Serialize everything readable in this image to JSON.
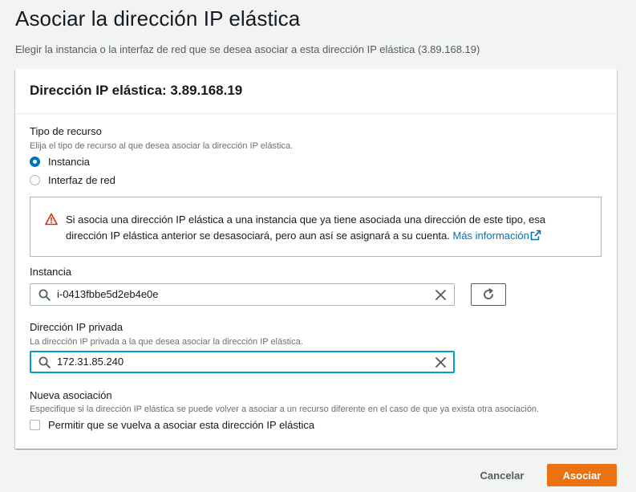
{
  "page": {
    "title": "Asociar la dirección IP elástica",
    "description": "Elegir la instancia o la interfaz de red que se desea asociar a esta dirección IP elástica (3.89.168.19)"
  },
  "panel": {
    "title": "Dirección IP elástica: 3.89.168.19"
  },
  "resource_type": {
    "label": "Tipo de recurso",
    "description": "Elija el tipo de recurso al que desea asociar la dirección IP elástica.",
    "options": [
      {
        "label": "Instancia",
        "selected": true
      },
      {
        "label": "Interfaz de red",
        "selected": false
      }
    ]
  },
  "alert": {
    "icon": "warning-icon",
    "text": "Si asocia una dirección IP elástica a una instancia que ya tiene asociada una dirección de este tipo, esa dirección IP elástica anterior se desasociará, pero aun así se asignará a su cuenta. ",
    "link_text": "Más información",
    "link_icon": "external-link-icon",
    "colors": {
      "warning": "#d13212",
      "link": "#0073bb"
    }
  },
  "instance": {
    "label": "Instancia",
    "value": "i-0413fbbe5d2eb4e0e"
  },
  "private_ip": {
    "label": "Dirección IP privada",
    "description": "La dirección IP privada a la que desea asociar la dirección IP elástica.",
    "value": "172.31.85.240"
  },
  "reassociation": {
    "label": "Nueva asociación",
    "description": "Especifique si la dirección IP elástica se puede volver a asociar a un recurso diferente en el caso de que ya exista otra asociación.",
    "checkbox_label": "Permitir que se vuelva a asociar esta dirección IP elástica",
    "checked": false
  },
  "actions": {
    "cancel_label": "Cancelar",
    "primary_label": "Asociar",
    "primary_color": "#ec7211"
  }
}
